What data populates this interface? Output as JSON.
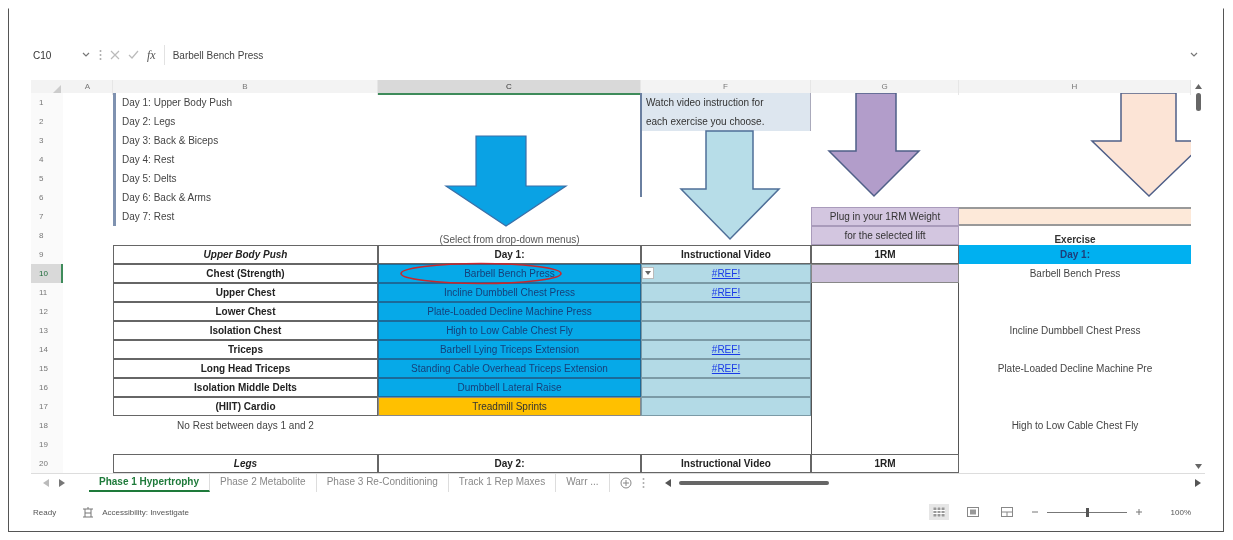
{
  "formula_bar": {
    "name_box": "C10",
    "function_label": "fx",
    "formula": "Barbell Bench Press"
  },
  "columns": [
    {
      "label": "A",
      "selected": false
    },
    {
      "label": "B",
      "selected": false
    },
    {
      "label": "C",
      "selected": true
    },
    {
      "label": "F",
      "selected": false
    },
    {
      "label": "G",
      "selected": false
    },
    {
      "label": "H",
      "selected": false
    }
  ],
  "rows": [
    {
      "number": "1",
      "selected": false,
      "cells": {
        "b": {
          "kind": "day_list",
          "text": "Day 1: Upper Body Push"
        },
        "f": {
          "kind": "note",
          "text": "Watch video instruction for"
        }
      }
    },
    {
      "number": "2",
      "selected": false,
      "cells": {
        "b": {
          "kind": "day_list",
          "text": "Day 2: Legs"
        },
        "f": {
          "kind": "note",
          "text": "each exercise you choose."
        }
      }
    },
    {
      "number": "3",
      "selected": false,
      "cells": {
        "b": {
          "kind": "day_list",
          "text": "Day 3: Back & Biceps"
        }
      }
    },
    {
      "number": "4",
      "selected": false,
      "cells": {
        "b": {
          "kind": "day_list",
          "text": "Day 4: Rest"
        }
      }
    },
    {
      "number": "5",
      "selected": false,
      "cells": {
        "b": {
          "kind": "day_list",
          "text": "Day 5: Delts"
        }
      }
    },
    {
      "number": "6",
      "selected": false,
      "cells": {
        "b": {
          "kind": "day_list",
          "text": "Day 6: Back & Arms"
        }
      }
    },
    {
      "number": "7",
      "selected": false,
      "cells": {
        "b": {
          "kind": "day_list",
          "text": "Day 7: Rest"
        },
        "g": {
          "kind": "rm_prompt",
          "text": "Plug in your 1RM Weight"
        },
        "h": {
          "kind": "peach"
        }
      }
    },
    {
      "number": "8",
      "selected": false,
      "cells": {
        "c": {
          "kind": "hint",
          "text": "(Select from drop-down menus)"
        },
        "g": {
          "kind": "rm_prompt",
          "text": "for the selected lift"
        },
        "h": {
          "kind": "caption",
          "text": "Exercise"
        }
      }
    },
    {
      "number": "9",
      "selected": false,
      "cells": {
        "b": {
          "kind": "section",
          "text": "Upper Body Push"
        },
        "c": {
          "kind": "header",
          "text": "Day 1:"
        },
        "f": {
          "kind": "header",
          "text": "Instructional Video"
        },
        "g": {
          "kind": "header",
          "text": "1RM"
        },
        "h": {
          "kind": "banner",
          "text": "Day 1:"
        }
      }
    },
    {
      "number": "10",
      "selected": true,
      "cells": {
        "b": {
          "kind": "label",
          "text": "Chest (Strength)"
        },
        "c": {
          "kind": "exercise",
          "text": "Barbell Bench Press"
        },
        "f": {
          "kind": "video",
          "text": "#REF!"
        },
        "g": {
          "kind": "rm_input"
        },
        "h": {
          "kind": "plain",
          "text": "Barbell Bench Press"
        }
      }
    },
    {
      "number": "11",
      "selected": false,
      "cells": {
        "b": {
          "kind": "label",
          "text": "Upper Chest"
        },
        "c": {
          "kind": "exercise",
          "text": "Incline Dumbbell Chest Press"
        },
        "f": {
          "kind": "video",
          "text": "#REF!"
        },
        "g": {
          "kind": "rm_col"
        }
      }
    },
    {
      "number": "12",
      "selected": false,
      "cells": {
        "b": {
          "kind": "label",
          "text": "Lower Chest"
        },
        "c": {
          "kind": "exercise",
          "text": "Plate-Loaded Decline Machine Press"
        },
        "f": {
          "kind": "video"
        },
        "g": {
          "kind": "rm_col"
        }
      }
    },
    {
      "number": "13",
      "selected": false,
      "cells": {
        "b": {
          "kind": "label",
          "text": "Isolation Chest"
        },
        "c": {
          "kind": "exercise",
          "text": "High to Low Cable Chest Fly"
        },
        "f": {
          "kind": "video"
        },
        "g": {
          "kind": "rm_col"
        },
        "h": {
          "kind": "plain",
          "text": "Incline Dumbbell Chest Press"
        }
      }
    },
    {
      "number": "14",
      "selected": false,
      "cells": {
        "b": {
          "kind": "label",
          "text": "Triceps"
        },
        "c": {
          "kind": "exercise",
          "text": "Barbell Lying Triceps Extension"
        },
        "f": {
          "kind": "video",
          "text": "#REF!"
        },
        "g": {
          "kind": "rm_col"
        }
      }
    },
    {
      "number": "15",
      "selected": false,
      "cells": {
        "b": {
          "kind": "label",
          "text": "Long Head Triceps"
        },
        "c": {
          "kind": "exercise",
          "text": "Standing Cable Overhead Triceps Extension"
        },
        "f": {
          "kind": "video",
          "text": "#REF!"
        },
        "g": {
          "kind": "rm_col"
        },
        "h": {
          "kind": "plain",
          "text": "Plate-Loaded Decline Machine Pre"
        }
      }
    },
    {
      "number": "16",
      "selected": false,
      "cells": {
        "b": {
          "kind": "label",
          "text": "Isolation Middle Delts"
        },
        "c": {
          "kind": "exercise",
          "text": "Dumbbell Lateral Raise"
        },
        "f": {
          "kind": "video"
        },
        "g": {
          "kind": "rm_col"
        }
      }
    },
    {
      "number": "17",
      "selected": false,
      "cells": {
        "b": {
          "kind": "label",
          "text": "(HIIT) Cardio"
        },
        "c": {
          "kind": "cardio",
          "text": "Treadmill Sprints"
        },
        "f": {
          "kind": "video"
        },
        "g": {
          "kind": "rm_col"
        }
      }
    },
    {
      "number": "18",
      "selected": false,
      "cells": {
        "b": {
          "kind": "plain",
          "text": "No Rest between days 1 and 2"
        },
        "g": {
          "kind": "rm_col"
        },
        "h": {
          "kind": "plain",
          "text": "High to Low Cable Chest Fly"
        }
      }
    },
    {
      "number": "19",
      "selected": false,
      "cells": {
        "g": {
          "kind": "rm_col"
        }
      }
    },
    {
      "number": "20",
      "selected": false,
      "cells": {
        "b": {
          "kind": "section",
          "text": "Legs"
        },
        "c": {
          "kind": "header",
          "text": "Day 2:"
        },
        "f": {
          "kind": "header",
          "text": "Instructional Video"
        },
        "g": {
          "kind": "header",
          "text": "1RM"
        }
      }
    }
  ],
  "sheet_tabs": [
    {
      "label": "Phase 1 Hypertrophy",
      "selected": true
    },
    {
      "label": "Phase 2 Metabolite",
      "selected": false
    },
    {
      "label": "Phase 3 Re-Conditioning",
      "selected": false
    },
    {
      "label": "Track 1 Rep Maxes",
      "selected": false
    },
    {
      "label": "Warr ...",
      "selected": false
    }
  ],
  "status_bar": {
    "status": "Ready",
    "accessibility": "Accessibility: Investigate",
    "views": [
      {
        "kind": "normal",
        "selected": true
      },
      {
        "kind": "page_layout",
        "selected": false
      },
      {
        "kind": "page_break",
        "selected": false
      }
    ],
    "zoom": {
      "level": 0.5,
      "reading": "100%"
    }
  }
}
